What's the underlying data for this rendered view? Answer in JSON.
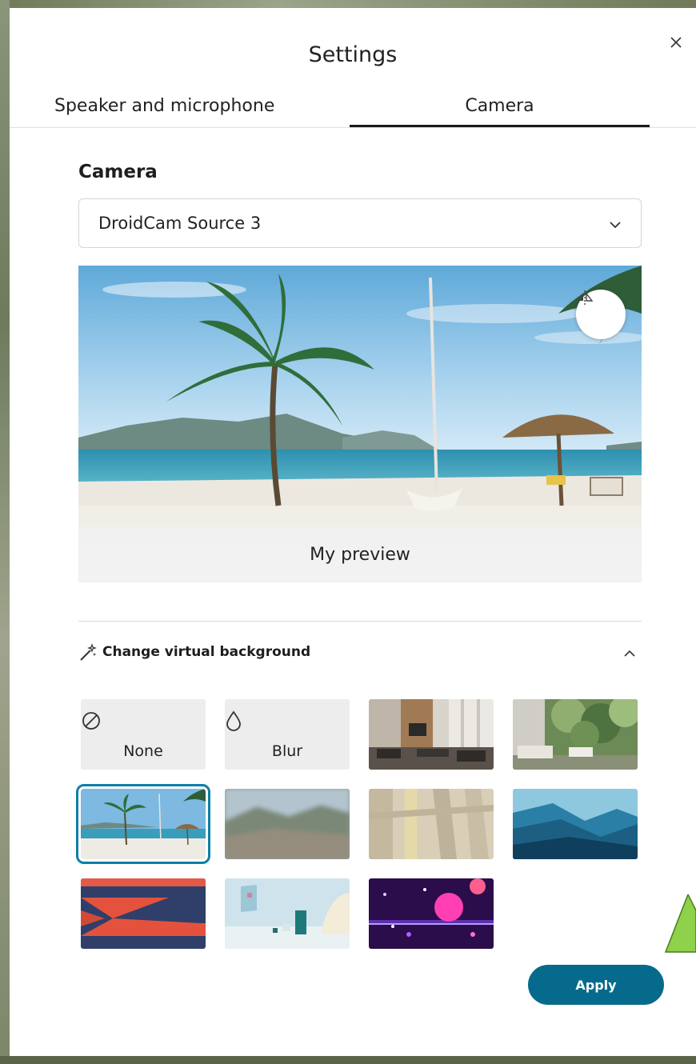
{
  "dialog": {
    "title": "Settings",
    "close_icon": "close-icon",
    "tabs": [
      {
        "label": "Speaker and microphone",
        "active": false
      },
      {
        "label": "Camera",
        "active": true
      }
    ]
  },
  "camera": {
    "section_title": "Camera",
    "selected_device": "DroidCam Source 3",
    "preview_label": "My preview",
    "mirror_icon": "mirror-flip-icon"
  },
  "virtual_background": {
    "header": "Change virtual background",
    "icon": "magic-wand-icon",
    "expanded": true,
    "tiles": [
      {
        "label": "None",
        "icon": "no-circle-icon",
        "type": "option"
      },
      {
        "label": "Blur",
        "icon": "droplet-icon",
        "type": "option"
      },
      {
        "type": "image",
        "scene": "office"
      },
      {
        "type": "image",
        "scene": "living-room-garden"
      },
      {
        "type": "image",
        "scene": "beach",
        "selected": true
      },
      {
        "type": "image",
        "scene": "blurred-mountains"
      },
      {
        "type": "image",
        "scene": "window-shadows"
      },
      {
        "type": "image",
        "scene": "blue-mountains"
      },
      {
        "type": "image",
        "scene": "red-navy-zigzag"
      },
      {
        "type": "image",
        "scene": "pastel-shapes"
      },
      {
        "type": "image",
        "scene": "purple-space"
      }
    ]
  },
  "footer": {
    "apply_label": "Apply"
  },
  "colors": {
    "accent": "#066a8c",
    "selection": "#0e7fa8",
    "annotation_arrow": "#8ed14a"
  }
}
